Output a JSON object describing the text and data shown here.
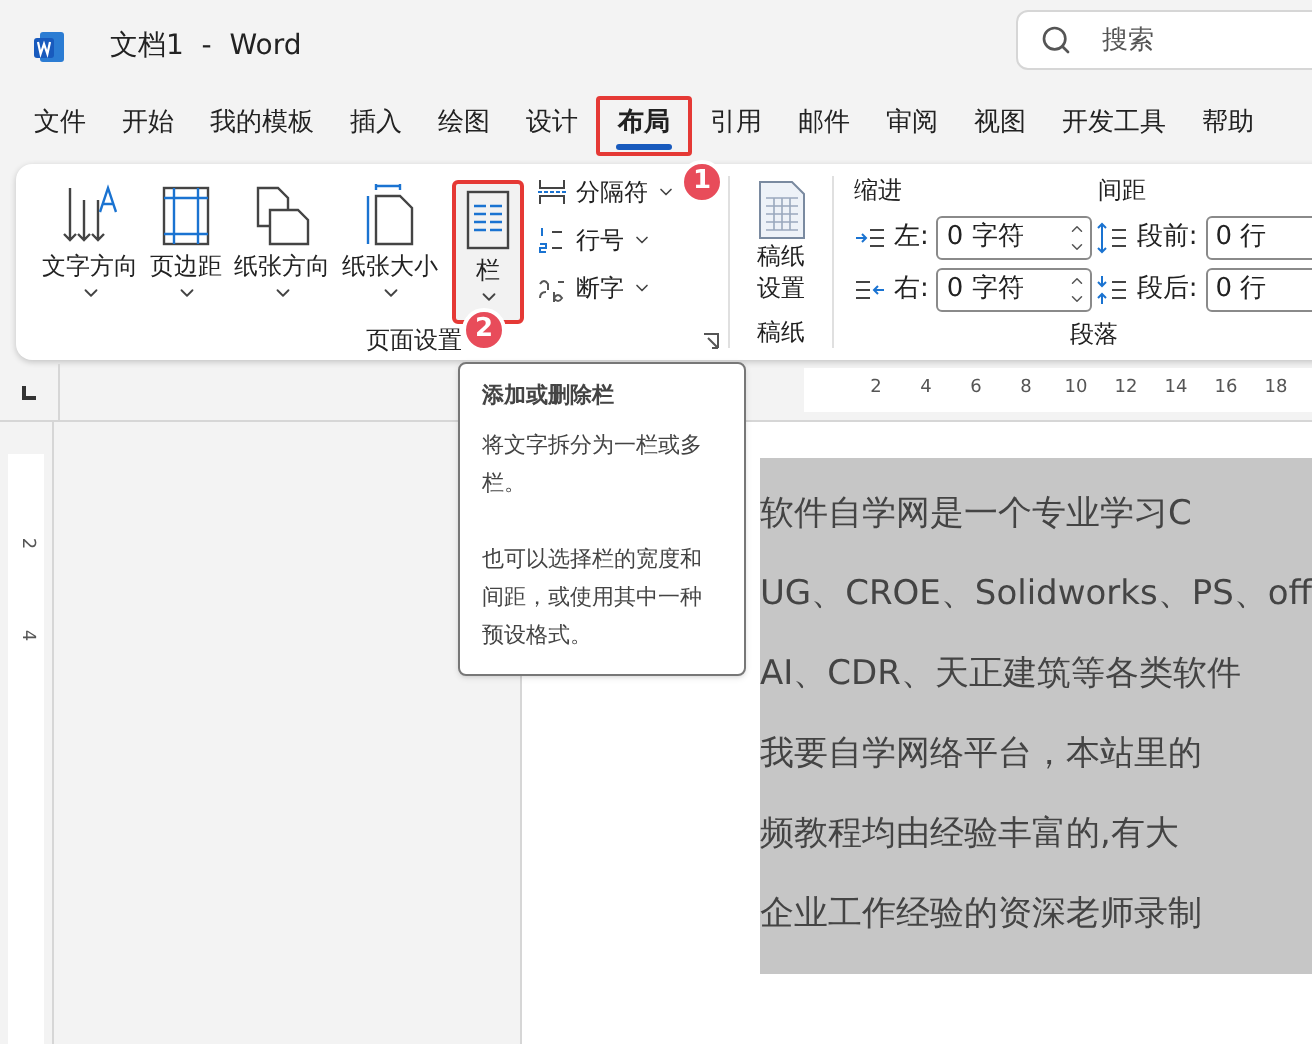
{
  "title_bar": {
    "app_title": "文档1  -  Word",
    "search": {
      "placeholder": "搜索"
    }
  },
  "menu_tabs": [
    {
      "label": "文件",
      "selected": false
    },
    {
      "label": "开始",
      "selected": false
    },
    {
      "label": "我的模板",
      "selected": false
    },
    {
      "label": "插入",
      "selected": false
    },
    {
      "label": "绘图",
      "selected": false
    },
    {
      "label": "设计",
      "selected": false
    },
    {
      "label": "布局",
      "selected": true,
      "callout": "1"
    },
    {
      "label": "引用",
      "selected": false
    },
    {
      "label": "邮件",
      "selected": false
    },
    {
      "label": "审阅",
      "selected": false
    },
    {
      "label": "视图",
      "selected": false
    },
    {
      "label": "开发工具",
      "selected": false
    },
    {
      "label": "帮助",
      "selected": false
    }
  ],
  "ribbon": {
    "page_setup": {
      "label": "页面设置",
      "large_buttons": [
        {
          "kind": "text-direction",
          "label": "文字方向"
        },
        {
          "kind": "margins",
          "label": "页边距"
        },
        {
          "kind": "orientation",
          "label": "纸张方向"
        },
        {
          "kind": "size",
          "label": "纸张大小"
        },
        {
          "kind": "columns",
          "label": "栏",
          "callout": "2"
        }
      ],
      "small_buttons": [
        {
          "kind": "breaks",
          "label": "分隔符"
        },
        {
          "kind": "line-numbers",
          "label": "行号"
        },
        {
          "kind": "hyphenation",
          "label": "断字"
        }
      ]
    },
    "manuscript": {
      "label": "稿纸",
      "button": "稿纸设置"
    },
    "paragraph": {
      "label": "段落",
      "indent": {
        "label": "缩进",
        "fields": [
          {
            "kind": "left",
            "label": "左:",
            "value": "0 字符"
          },
          {
            "kind": "right",
            "label": "右:",
            "value": "0 字符"
          }
        ]
      },
      "spacing": {
        "label": "间距",
        "fields": [
          {
            "kind": "before",
            "label": "段前:",
            "value": "0 行"
          },
          {
            "kind": "after",
            "label": "段后:",
            "value": "0 行"
          }
        ]
      }
    }
  },
  "tooltip": {
    "title": "添加或删除栏",
    "paragraphs": [
      "将文字拆分为一栏或多栏。",
      "也可以选择栏的宽度和间距，或使用其中一种预设格式。"
    ]
  },
  "horizontal_ruler": {
    "numbers": [
      "2",
      "4",
      "6",
      "8",
      "10",
      "12",
      "14",
      "16",
      "18"
    ]
  },
  "vertical_ruler": {
    "numbers": [
      "2",
      "4"
    ]
  },
  "document": {
    "selected": true,
    "lines": [
      "软件自学网是一个专业学习C",
      "UG、CROE、Solidworks、PS、off",
      "AI、CDR、天正建筑等各类软件",
      "我要自学网络平台，本站里的",
      "频教程均由经验丰富的,有大",
      "企业工作经验的资深老师录制"
    ]
  }
}
